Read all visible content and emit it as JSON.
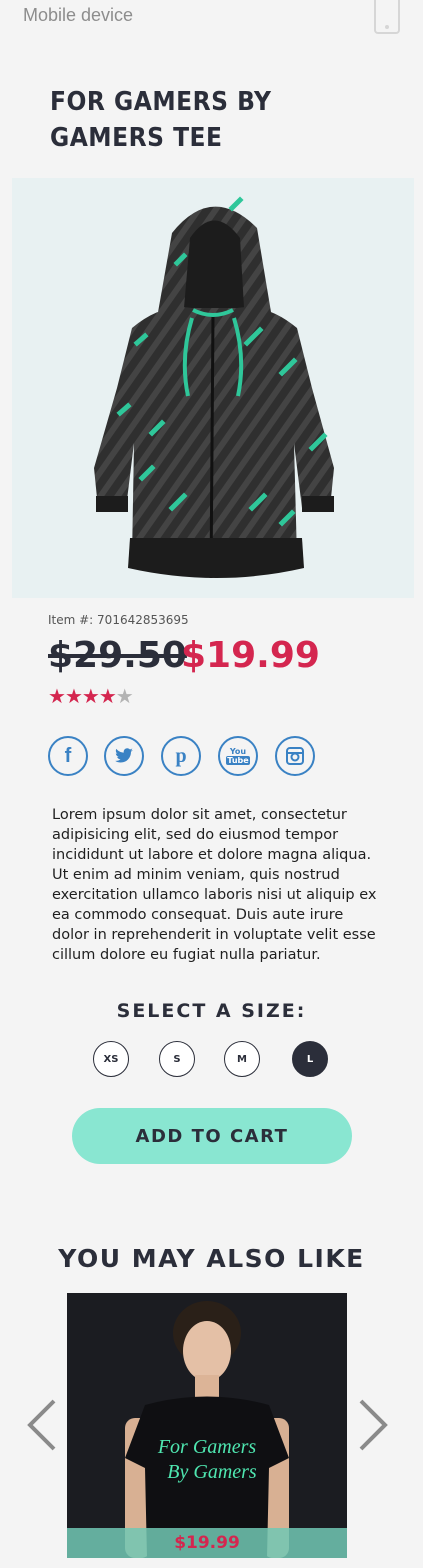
{
  "device_label": "Mobile device",
  "product": {
    "title": "FOR GAMERS BY GAMERS TEE",
    "item_number": "Item #: 701642853695",
    "old_price": "$29.50",
    "new_price": "$19.99",
    "rating": 4,
    "rating_max": 5,
    "description": "Lorem ipsum dolor sit amet, consectetur adipisicing elit, sed do eiusmod tempor incididunt ut labore et dolore magna aliqua. Ut enim ad minim veniam, quis nostrud exercitation ullamco laboris nisi ut aliquip ex ea commodo consequat. Duis aute irure dolor in reprehenderit in voluptate velit esse cillum dolore eu fugiat nulla pariatur."
  },
  "social": {
    "facebook": "f",
    "twitter": "t",
    "pinterest": "p",
    "youtube_top": "You",
    "youtube_bottom": "Tube",
    "instagram": "instagram"
  },
  "sizes": {
    "heading": "SELECT A SIZE:",
    "options": [
      "XS",
      "S",
      "M",
      "L"
    ],
    "selected": "L"
  },
  "cart": {
    "label": "ADD TO CART"
  },
  "recommendations": {
    "heading": "YOU MAY ALSO LIKE",
    "items": [
      {
        "price": "$19.99",
        "shirt_text_line1": "For Gamers",
        "shirt_text_line2": "By Gamers"
      }
    ]
  },
  "colors": {
    "accent": "#d4264f",
    "cart_button": "#89e6d1",
    "social_blue": "#3a82c4",
    "dark": "#2b2e3a"
  }
}
